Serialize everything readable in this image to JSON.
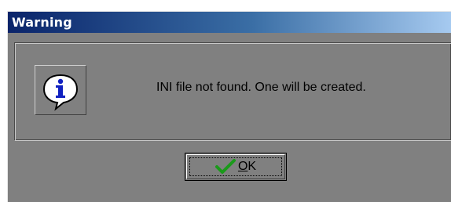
{
  "window": {
    "title": "Warning"
  },
  "message": {
    "text": "INI file not found. One will be created.",
    "icon": "info-icon"
  },
  "buttons": {
    "ok_mnemonic": "O",
    "ok_rest": "K",
    "ok_icon": "checkmark-icon"
  },
  "colors": {
    "dialog_bg": "#808080",
    "title_start": "#0a246a",
    "title_end": "#a6caf0",
    "checkmark": "#1a9a1a",
    "info_blue": "#1020c0"
  }
}
